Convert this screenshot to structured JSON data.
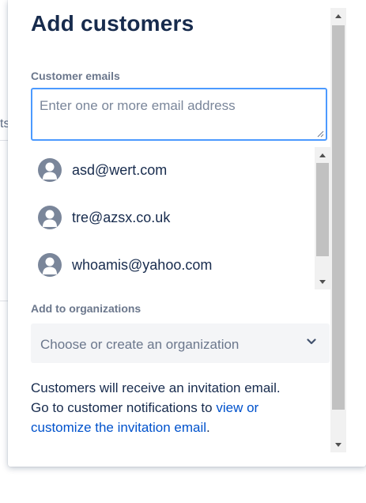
{
  "background": {
    "fragment_text": "ts"
  },
  "dialog": {
    "title": "Add customers",
    "emails_label": "Customer emails",
    "emails_placeholder": "Enter one or more email address",
    "suggestions": [
      {
        "email": "asd@wert.com",
        "icon": "user-avatar-icon"
      },
      {
        "email": "tre@azsx.co.uk",
        "icon": "user-avatar-icon"
      },
      {
        "email": "whoamis@yahoo.com",
        "icon": "user-avatar-icon"
      }
    ],
    "org_label": "Add to organizations",
    "org_placeholder": "Choose or create an organization",
    "info_line1": "Customers will receive an invitation email.",
    "info_line2_prefix": "Go to customer notifications to ",
    "info_link": "view or customize the invitation email",
    "info_suffix": "."
  },
  "colors": {
    "title": "#172b4d",
    "label": "#6b778c",
    "focus_border": "#4c9aff",
    "link": "#0052cc",
    "avatar": "#7a869a",
    "select_bg": "#f4f5f7"
  }
}
